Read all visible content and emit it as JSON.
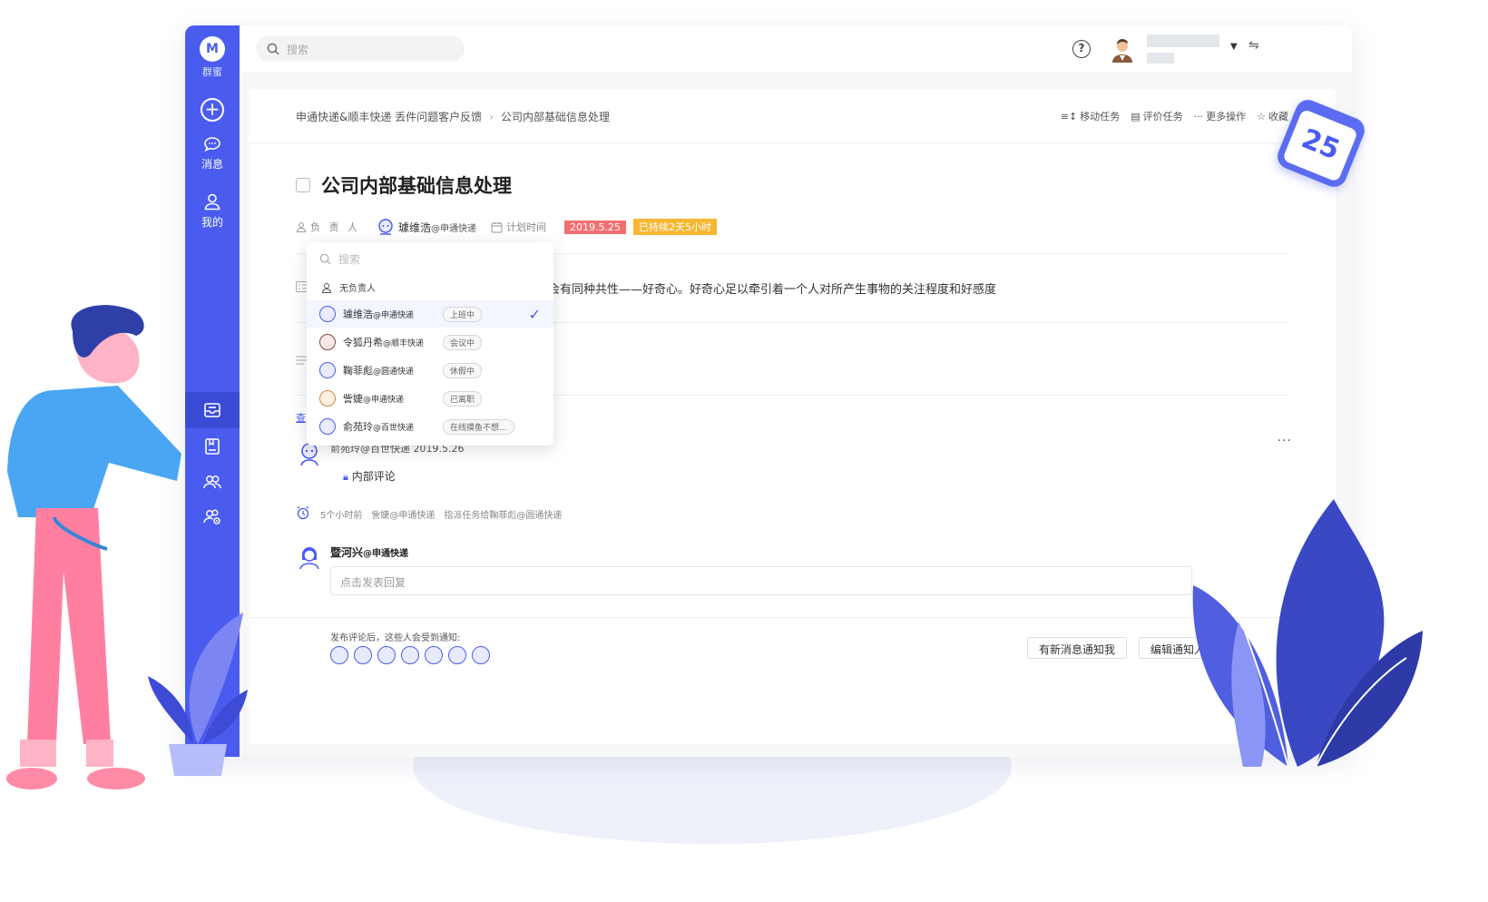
{
  "app": {
    "logo_text": "M",
    "logo_label": "群蜜",
    "nav": {
      "messages": "消息",
      "mine": "我的"
    }
  },
  "topbar": {
    "search_placeholder": "搜索",
    "help": "?"
  },
  "breadcrumb": {
    "project": "申通快递&顺丰快递 丢件问题客户反馈",
    "current": "公司内部基础信息处理"
  },
  "actions": {
    "move": "移动任务",
    "rate": "评价任务",
    "more": "更多操作",
    "fav": "收藏"
  },
  "task": {
    "title": "公司内部基础信息处理",
    "owner_label": "负 责 人",
    "owner_name": "璩维浩",
    "owner_org": "@申通快递",
    "plan_label": "计划时间",
    "date_tag": "2019.5.25",
    "duration_tag": "已持续2天5小时",
    "description_visible": "会有同种共性——好奇心。好奇心足以牵引着一个人对所产生事物的关注程度和好感度"
  },
  "comment": {
    "author_visible": "俞苑玲@百世快递  2019.5.26",
    "lock_label": "内部评论",
    "view_link": "查"
  },
  "activity": {
    "time": "5个小时前",
    "actor": "訾婕@申通快递",
    "text": "指派任务给鞠菲彪@圆通快递"
  },
  "reply": {
    "name": "暨河兴",
    "org": "@申通快递",
    "placeholder": "点击发表回复"
  },
  "notify": {
    "label": "发布评论后，这些人会受到通知:",
    "btn_notify_me": "有新消息通知我",
    "btn_edit": "编辑通知人员"
  },
  "dropdown": {
    "search_placeholder": "搜索",
    "none_label": "无负责人",
    "items": [
      {
        "name": "璩维浩",
        "org": "@申通快递",
        "status": "上班中",
        "selected": true
      },
      {
        "name": "令狐丹希",
        "org": "@顺丰快递",
        "status": "会议中",
        "selected": false
      },
      {
        "name": "鞠菲彪",
        "org": "@圆通快递",
        "status": "休假中",
        "selected": false
      },
      {
        "name": "訾婕",
        "org": "@申通快递",
        "status": "已离职",
        "selected": false
      },
      {
        "name": "俞苑玲",
        "org": "@百世快递",
        "status": "在线摸鱼不想...",
        "selected": false
      }
    ]
  },
  "calendar_badge": "25",
  "colors": {
    "brand": "#4a5cf0",
    "date_tag": "#f36f72",
    "duration_tag": "#f7b733"
  }
}
